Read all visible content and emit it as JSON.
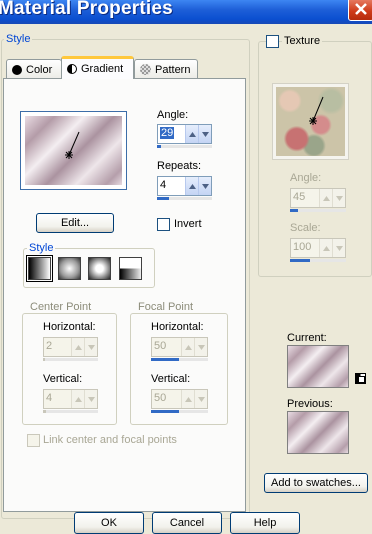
{
  "window": {
    "title": "Material Properties"
  },
  "style_group": {
    "label": "Style",
    "tabs": [
      {
        "label": "Color",
        "icon": "color-circle-icon"
      },
      {
        "label": "Gradient",
        "icon": "gradient-half-circle-icon"
      },
      {
        "label": "Pattern",
        "icon": "pattern-icon"
      }
    ],
    "active_tab": "Gradient"
  },
  "gradient": {
    "edit_label": "Edit...",
    "angle_label": "Angle:",
    "angle_value": "29",
    "repeats_label": "Repeats:",
    "repeats_value": "4",
    "invert_label": "Invert",
    "invert_checked": false,
    "style_label": "Style",
    "styles": [
      "linear-gradient-icon",
      "rectangular-gradient-icon",
      "sunburst-gradient-icon",
      "radial-gradient-icon"
    ],
    "center_point": {
      "label": "Center Point",
      "horizontal_label": "Horizontal:",
      "horizontal_value": "2",
      "vertical_label": "Vertical:",
      "vertical_value": "4"
    },
    "focal_point": {
      "label": "Focal Point",
      "horizontal_label": "Horizontal:",
      "horizontal_value": "50",
      "vertical_label": "Vertical:",
      "vertical_value": "50"
    },
    "link_label": "Link center and focal points",
    "link_checked": false
  },
  "texture": {
    "label": "Texture",
    "checked": false,
    "angle_label": "Angle:",
    "angle_value": "45",
    "scale_label": "Scale:",
    "scale_value": "100"
  },
  "swatches": {
    "current_label": "Current:",
    "previous_label": "Previous:",
    "add_label": "Add to swatches..."
  },
  "buttons": {
    "ok": "OK",
    "cancel": "Cancel",
    "help": "Help"
  },
  "colors": {
    "title_bar": "#0b4fd0",
    "accent": "#316ac5",
    "group_label": "#0046d5"
  }
}
